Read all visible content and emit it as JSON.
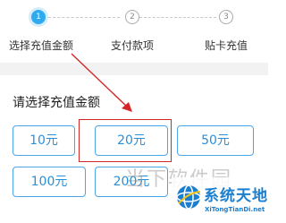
{
  "steps": [
    {
      "number": "1",
      "label": "选择充值金额",
      "state": "active"
    },
    {
      "number": "2",
      "label": "支付款项",
      "state": "inactive"
    },
    {
      "number": "3",
      "label": "贴卡充值",
      "state": "inactive"
    }
  ],
  "section_title": "请选择充值金额",
  "amounts": [
    "10元",
    "20元",
    "50元",
    "100元",
    "200元"
  ],
  "highlighted_amount": "20元",
  "colors": {
    "accent": "#2eaaf0",
    "option_border": "#4aa6e6",
    "option_text": "#2b8fd8",
    "annotation": "#d42626"
  },
  "watermarks": {
    "center_text": "当下软件园",
    "logo_cn": "系统天地",
    "logo_en": "XiTongTianDi.net"
  }
}
